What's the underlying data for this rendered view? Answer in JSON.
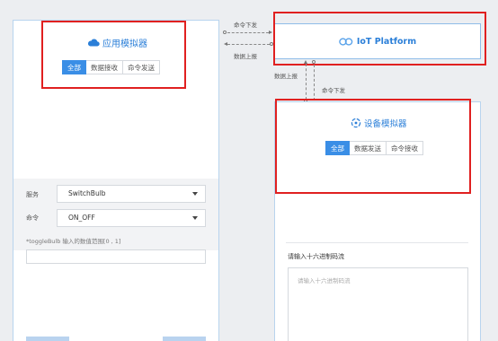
{
  "app_simulator": {
    "title": "应用模拟器",
    "tabs": [
      {
        "label": "全部",
        "active": true
      },
      {
        "label": "数据接收",
        "active": false
      },
      {
        "label": "命令发送",
        "active": false
      }
    ],
    "service_label": "服务",
    "service_value": "SwitchBulb",
    "command_label": "命令",
    "command_value": "ON_OFF",
    "hint": "*toggleBulb 输入的数值范围[0 , 1]"
  },
  "iot_platform": {
    "title": "IoT Platform"
  },
  "flows": {
    "cmd_down_top": "命令下发",
    "data_up_top": "数据上报",
    "data_up_side": "数据上报",
    "cmd_down_side": "命令下发"
  },
  "device_simulator": {
    "title": "设备模拟器",
    "tabs": [
      {
        "label": "全部",
        "active": true
      },
      {
        "label": "数据发送",
        "active": false
      },
      {
        "label": "命令接收",
        "active": false
      }
    ],
    "hex_label": "请输入十六进制码流",
    "hex_placeholder": "请输入十六进制码流"
  },
  "colors": {
    "accent": "#3a8ee6",
    "highlight": "#e02020"
  }
}
